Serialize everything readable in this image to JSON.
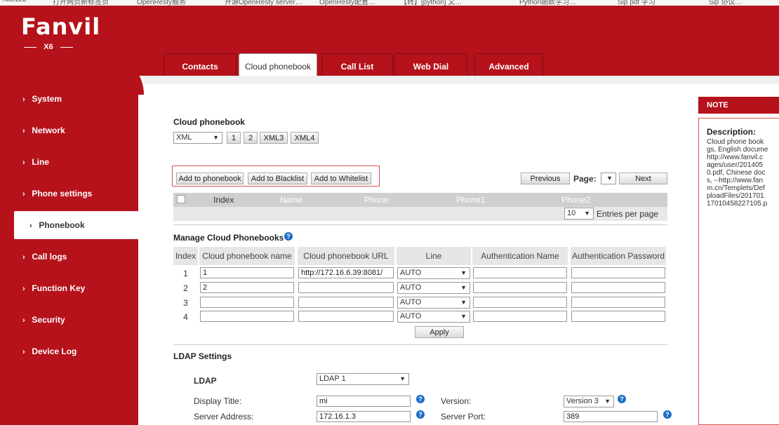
{
  "bookmarks": [
    "hao123",
    "打开网页新标签页",
    "OpenResty服务",
    "开源OpenResty server…",
    "OpenResty配置…",
    "【转】[python] 文…",
    "Python函数学习…",
    "Sip pdf 学习",
    "Sip 协议…"
  ],
  "brand": {
    "logo": "Fanvil",
    "model": "X6"
  },
  "tabs": [
    "Contacts",
    "Cloud phonebook",
    "Call List",
    "Web Dial",
    "Advanced"
  ],
  "sidebar": [
    "System",
    "Network",
    "Line",
    "Phone settings",
    "Phonebook",
    "Call logs",
    "Function Key",
    "Security",
    "Device Log"
  ],
  "cloud": {
    "title": "Cloud phonebook",
    "type": "XML",
    "pages": [
      "1",
      "2",
      "XML3",
      "XML4"
    ],
    "add_phonebook": "Add to phonebook",
    "add_blacklist": "Add to Blacklist",
    "add_whitelist": "Add to Whitelist",
    "previous": "Previous",
    "page_label": "Page:",
    "next": "Next",
    "columns": [
      "Index",
      "Name",
      "Phone",
      "Phone1",
      "Phone2"
    ],
    "entries_value": "10",
    "entries_label": "Entries per page"
  },
  "manage": {
    "title": "Manage Cloud Phonebooks",
    "headers": [
      "Index",
      "Cloud phonebook name",
      "Cloud phonebook URL",
      "Line",
      "Authentication Name",
      "Authentication Password"
    ],
    "rows": [
      {
        "index": "1",
        "name": "1",
        "url": "http://172.16.6.39:8081/",
        "line": "AUTO",
        "auth_name": "",
        "auth_pass": ""
      },
      {
        "index": "2",
        "name": "2",
        "url": "",
        "line": "AUTO",
        "auth_name": "",
        "auth_pass": ""
      },
      {
        "index": "3",
        "name": "",
        "url": "",
        "line": "AUTO",
        "auth_name": "",
        "auth_pass": ""
      },
      {
        "index": "4",
        "name": "",
        "url": "",
        "line": "AUTO",
        "auth_name": "",
        "auth_pass": ""
      }
    ],
    "apply": "Apply"
  },
  "ldap": {
    "title": "LDAP Settings",
    "ldap_label": "LDAP",
    "ldap_value": "LDAP 1",
    "display_title_label": "Display Title:",
    "display_title_value": "mi",
    "version_label": "Version:",
    "version_value": "Version 3",
    "server_address_label": "Server Address:",
    "server_address_value": "172.16.1.3",
    "server_port_label": "Server Port:",
    "server_port_value": "389"
  },
  "note": {
    "title": "NOTE",
    "desc_title": "Description:",
    "desc_text": "Cloud phone book\ngs, English docume\nhttp://www.fanvil.c\nages/user/201405\n0.pdf, Chinese doc\ns, --http://www.fan\nm.cn/Templets/Def\nploadFiles/201701\n17010458227105.p"
  },
  "colors": {
    "brand_red": "#b5121b",
    "help_blue": "#1e6fc4"
  }
}
